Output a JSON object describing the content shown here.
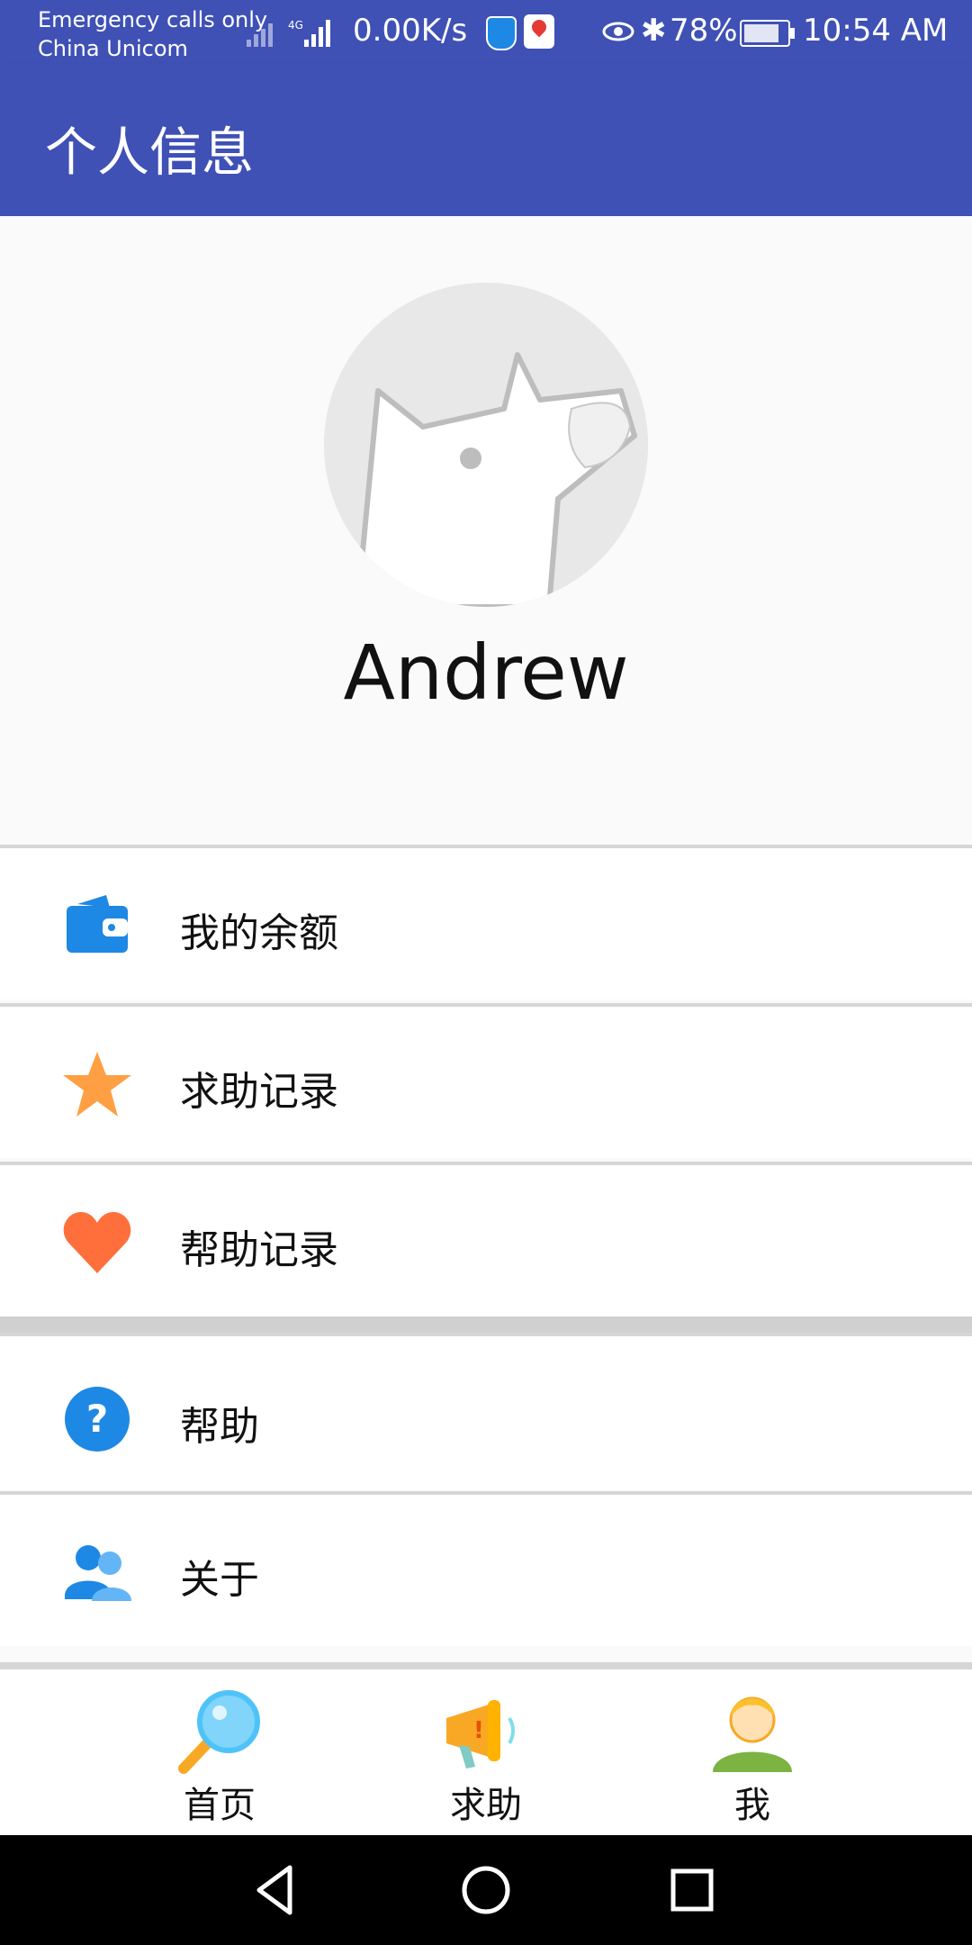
{
  "status_bar": {
    "carrier_line1": "Emergency calls only",
    "carrier_line2": "China Unicom",
    "network_speed": "0.00K/s",
    "battery": "78%",
    "time": "10:54 AM"
  },
  "app_bar": {
    "title": "个人信息"
  },
  "profile": {
    "username": "Andrew"
  },
  "menu": {
    "items": [
      {
        "label": "我的余额",
        "icon": "wallet-icon"
      },
      {
        "label": "求助记录",
        "icon": "star-icon"
      },
      {
        "label": "帮助记录",
        "icon": "heart-icon"
      },
      {
        "label": "帮助",
        "icon": "question-icon"
      },
      {
        "label": "关于",
        "icon": "users-icon"
      }
    ]
  },
  "bottom_nav": {
    "items": [
      {
        "label": "首页",
        "icon": "magnifier-icon"
      },
      {
        "label": "求助",
        "icon": "megaphone-icon"
      },
      {
        "label": "我",
        "icon": "person-icon"
      }
    ]
  },
  "colors": {
    "primary": "#3f51b5",
    "wallet": "#1e88e5",
    "star": "#ff9f43",
    "heart": "#ff6f3c",
    "question": "#1e88e5"
  }
}
